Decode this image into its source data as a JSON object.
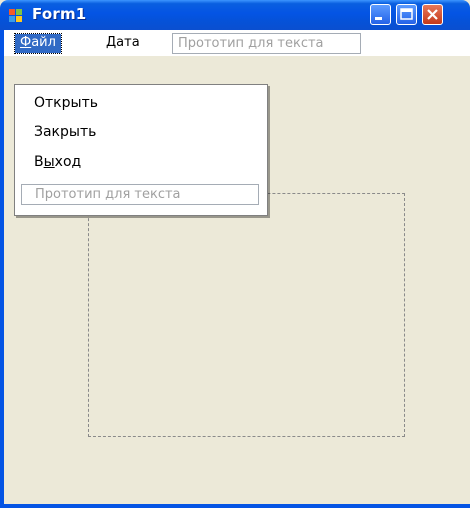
{
  "window": {
    "title": "Form1"
  },
  "menubar": {
    "file_label_char": "Ф",
    "file_label_rest": "айл",
    "date_label": "Дата",
    "textbox_placeholder": "Прототип для текста"
  },
  "file_menu": {
    "open_label": "Открыть",
    "close_label": "Закрыть",
    "exit_label_pre": "В",
    "exit_label_char": "ы",
    "exit_label_post": "ход",
    "textbox_placeholder": "Прототип для текста"
  },
  "icons": {
    "app": "windows-app-icon",
    "minimize": "minimize-icon",
    "maximize": "maximize-icon",
    "close": "close-icon"
  },
  "colors": {
    "titlebar": "#0454e4",
    "menu_highlight": "#316ac5",
    "form_background": "#ece9d8",
    "close_button": "#c3391a"
  }
}
